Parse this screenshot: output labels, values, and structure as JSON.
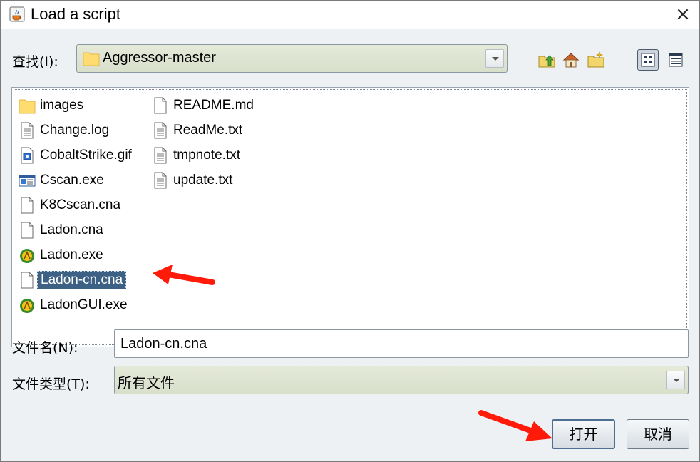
{
  "window": {
    "title": "Load a script",
    "close_glyph": "×",
    "title_icon": "java-cup-icon"
  },
  "lookin": {
    "label": "查找(I):",
    "value": "Aggressor-master",
    "folder_icon": "folder-icon"
  },
  "toolbar": {
    "icons": [
      "up-one-level-icon",
      "home-icon",
      "new-folder-icon"
    ],
    "views": [
      "list-view-icon",
      "details-view-icon"
    ]
  },
  "files": {
    "column1": [
      {
        "name": "images",
        "icon": "folder-icon"
      },
      {
        "name": "Change.log",
        "icon": "text-file-icon"
      },
      {
        "name": "CobaltStrike.gif",
        "icon": "image-file-icon"
      },
      {
        "name": "Cscan.exe",
        "icon": "exe-window-icon"
      },
      {
        "name": "K8Cscan.cna",
        "icon": "blank-file-icon"
      },
      {
        "name": "Ladon.cna",
        "icon": "blank-file-icon"
      },
      {
        "name": "Ladon.exe",
        "icon": "ladon-app-icon"
      },
      {
        "name": "Ladon-cn.cna",
        "icon": "blank-file-icon",
        "selected": true
      },
      {
        "name": "LadonGUI.exe",
        "icon": "ladon-app-icon"
      }
    ],
    "column2": [
      {
        "name": "README.md",
        "icon": "blank-file-icon"
      },
      {
        "name": "ReadMe.txt",
        "icon": "text-file-icon"
      },
      {
        "name": "tmpnote.txt",
        "icon": "text-file-icon"
      },
      {
        "name": "update.txt",
        "icon": "text-file-icon"
      }
    ]
  },
  "filename": {
    "label": "文件名(N):",
    "value": "Ladon-cn.cna"
  },
  "filetype": {
    "label": "文件类型(T):",
    "value": "所有文件"
  },
  "buttons": {
    "open": "打开",
    "cancel": "取消"
  },
  "colors": {
    "selection": "#3d6185",
    "annotation_arrow": "#ff1a0a",
    "combo_bg": "#dfe5d2"
  }
}
